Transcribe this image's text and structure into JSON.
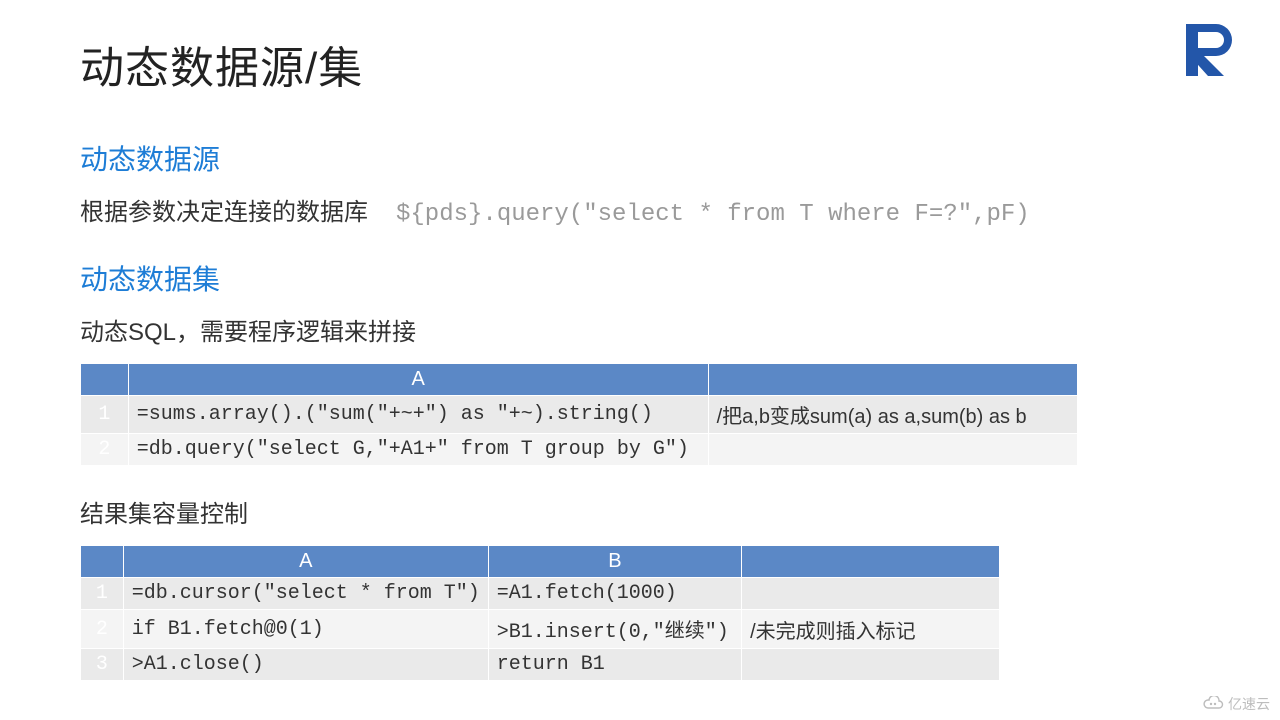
{
  "title": "动态数据源/集",
  "section1": {
    "heading": "动态数据源",
    "desc": "根据参数决定连接的数据库",
    "code": "${pds}.query(\"select * from T where F=?\",pF)"
  },
  "section2": {
    "heading": "动态数据集",
    "desc": "动态SQL，需要程序逻辑来拼接",
    "table": {
      "headers": [
        "",
        "A",
        ""
      ],
      "rows": [
        {
          "n": "1",
          "a": "=sums.array().(\"sum(\"+~+\") as \"+~).string()",
          "c": "/把a,b变成sum(a) as a,sum(b) as b"
        },
        {
          "n": "2",
          "a": "=db.query(\"select G,\"+A1+\" from T group by G\")",
          "c": ""
        }
      ]
    }
  },
  "section3": {
    "heading": "结果集容量控制",
    "table": {
      "headers": [
        "",
        "A",
        "B",
        ""
      ],
      "rows": [
        {
          "n": "1",
          "a": "=db.cursor(\"select * from T\")",
          "b": "=A1.fetch(1000)",
          "c": ""
        },
        {
          "n": "2",
          "a": "if B1.fetch@0(1)",
          "b": ">B1.insert(0,\"继续\")",
          "c": "/未完成则插入标记"
        },
        {
          "n": "3",
          "a": ">A1.close()",
          "b": "return B1",
          "c": ""
        }
      ]
    }
  },
  "watermark": "亿速云",
  "logo_color": "#2356a9"
}
